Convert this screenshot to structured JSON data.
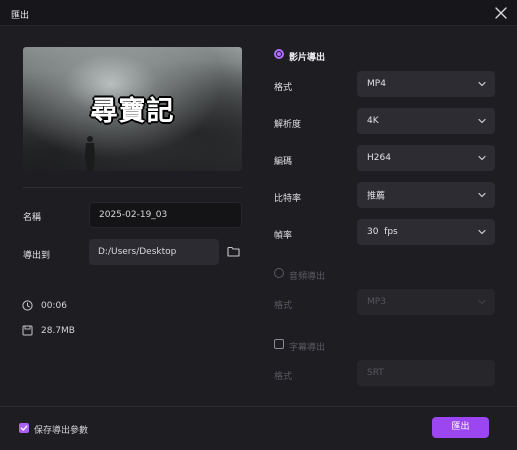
{
  "window": {
    "title": "匯出"
  },
  "preview": {
    "title_text": "尋寶記"
  },
  "file": {
    "name_label": "名稱",
    "name_value": "2025-02-19_03",
    "export_to_label": "導出到",
    "export_path": "D:/Users/Desktop",
    "duration": "00:06",
    "size": "28.7MB"
  },
  "video_export": {
    "label": "影片導出",
    "format_label": "格式",
    "format_value": "MP4",
    "resolution_label": "解析度",
    "resolution_value": "4K",
    "encoding_label": "編碼",
    "encoding_value": "H264",
    "bitrate_label": "比特率",
    "bitrate_value": "推薦",
    "framerate_label": "幀率",
    "framerate_value": "30  fps"
  },
  "audio_export": {
    "label": "音頻導出",
    "format_label": "格式",
    "format_value": "MP3"
  },
  "subtitle_export": {
    "label": "字幕導出",
    "format_label": "格式",
    "format_value": "SRT"
  },
  "footer": {
    "save_params_label": "保存導出參數",
    "export_button": "匯出"
  },
  "colors": {
    "accent": "#9b46f0",
    "background": "#1d1d22"
  }
}
